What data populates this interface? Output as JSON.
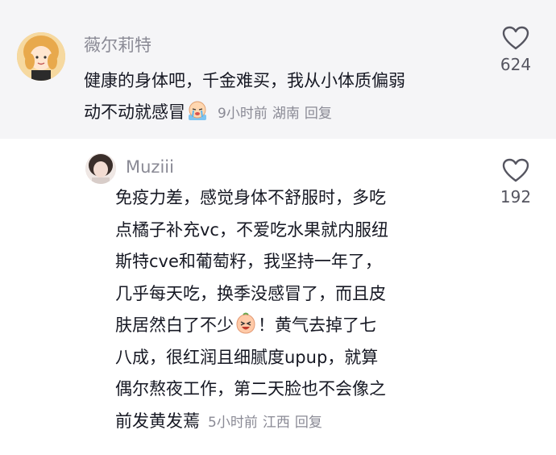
{
  "comment": {
    "username": "薇尔莉特",
    "lines": [
      "健康的身体吧，千金难买，我从小体质偏弱",
      "动不动就感冒"
    ],
    "emoji": "crying-face-emoji",
    "time": "9小时前",
    "location": "湖南",
    "reply_label": "回复",
    "like_count": "624"
  },
  "reply": {
    "username": "Muziii",
    "lines": [
      "免疫力差，感觉身体不舒服时，多吃",
      "点橘子补充vc，不爱吃水果就内服纽",
      "斯特cve和葡萄籽，我坚持一年了，",
      "几乎每天吃，换季没感冒了，而且皮",
      "肤居然白了不少",
      "！黄气去掉了七",
      "八成，很红润且细腻度upup，就算",
      "偶尔熬夜工作，第二天脸也不会像之",
      "前发黄发蔫"
    ],
    "emoji": "laughing-face-emoji",
    "time": "5小时前",
    "location": "江西",
    "reply_label": "回复",
    "like_count": "192"
  },
  "colors": {
    "top_bg": "#f5f5f7",
    "text": "#161823",
    "secondary": "#8a8a95"
  }
}
